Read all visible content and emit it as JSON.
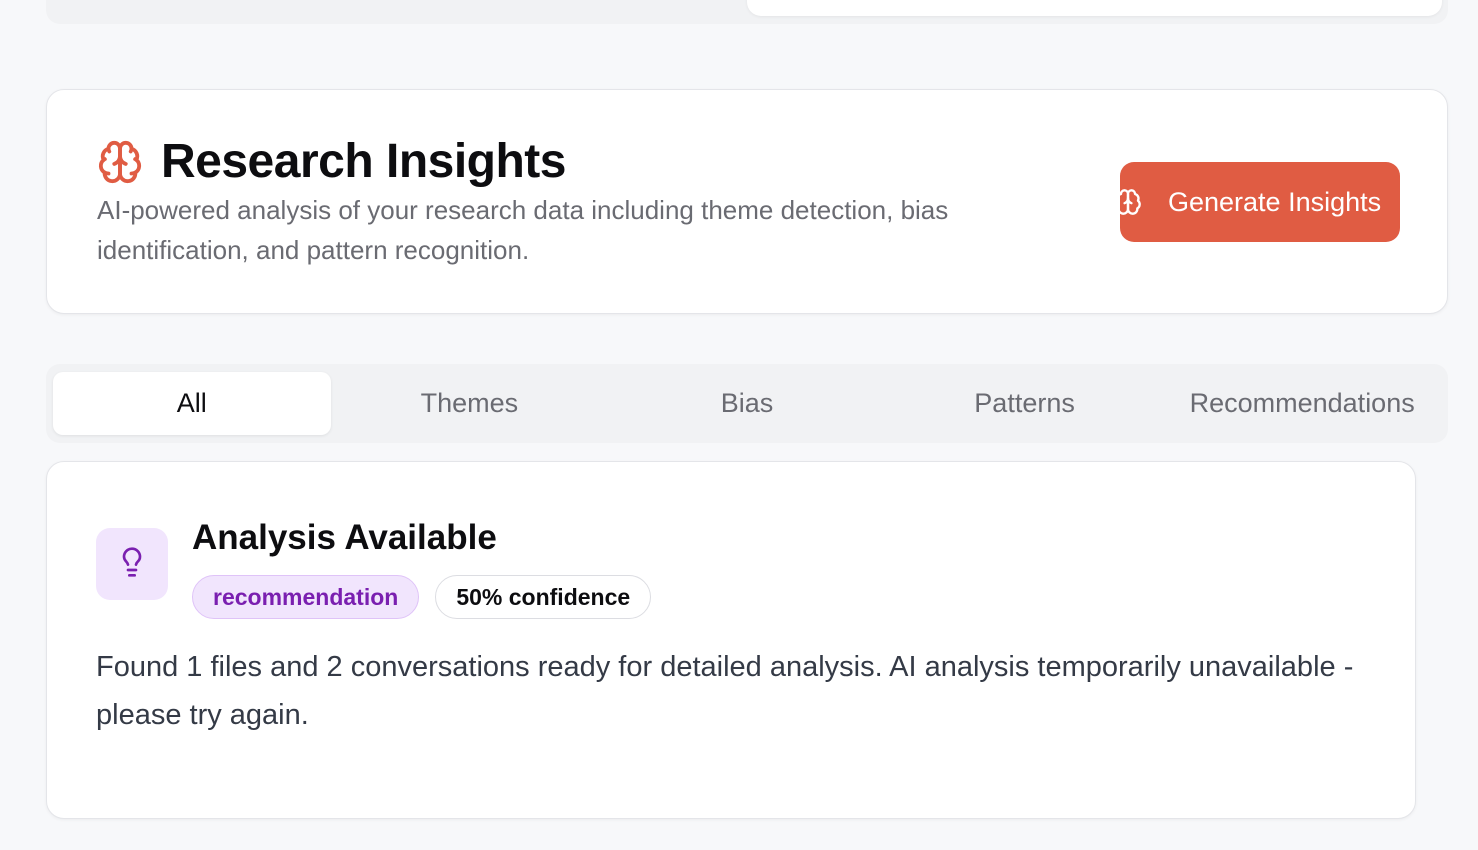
{
  "header": {
    "title": "Research Insights",
    "description": "AI-powered analysis of your research data including theme detection, bias identification, and pattern recognition.",
    "generate_button_label": "Generate Insights",
    "title_icon": "brain-icon",
    "accent_color": "#e05c43"
  },
  "tabs": [
    {
      "label": "All",
      "active": true
    },
    {
      "label": "Themes",
      "active": false
    },
    {
      "label": "Bias",
      "active": false
    },
    {
      "label": "Patterns",
      "active": false
    },
    {
      "label": "Recommendations",
      "active": false
    }
  ],
  "insight": {
    "icon": "lightbulb-icon",
    "title": "Analysis Available",
    "type_badge": "recommendation",
    "confidence_badge": "50% confidence",
    "body": "Found 1 files and 2 conversations ready for detailed analysis. AI analysis temporarily unavailable - please try again.",
    "accent_color": "#7a1fb0"
  }
}
